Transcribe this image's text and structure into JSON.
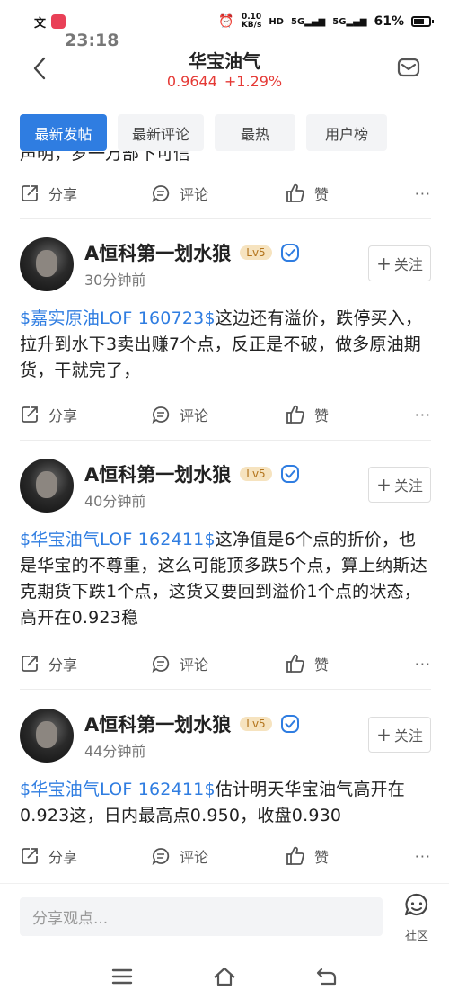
{
  "status": {
    "time": "23:18",
    "speed_value": "0.10",
    "speed_unit": "KB/s",
    "hd": "HD",
    "sig1": "5G",
    "sig2": "5G",
    "battery": "61%"
  },
  "header": {
    "title": "华宝油气",
    "price": "0.9644",
    "change": "+1.29%"
  },
  "tabs": [
    {
      "label": "最新发帖",
      "active": true
    },
    {
      "label": "最新评论",
      "active": false
    },
    {
      "label": "最热",
      "active": false
    },
    {
      "label": "用户榜",
      "active": false
    }
  ],
  "clipped_text": "声明，罗一万部下可信",
  "actions": {
    "share": "分享",
    "comment": "评论",
    "like": "赞",
    "more": "···"
  },
  "posts": [
    {
      "username": "A恒科第一划水狼",
      "level": "Lv5",
      "time": "30分钟前",
      "follow": "关注",
      "tag": "$嘉实原油LOF 160723$",
      "text": "这边还有溢价，跌停买入，拉升到水下3卖出赚7个点，反正是不破，做多原油期货，干就完了，"
    },
    {
      "username": "A恒科第一划水狼",
      "level": "Lv5",
      "time": "40分钟前",
      "follow": "关注",
      "tag": "$华宝油气LOF 162411$",
      "text": "这净值是6个点的折价，也是华宝的不尊重，这么可能顶多跌5个点，算上纳斯达克期货下跌1个点，这货又要回到溢价1个点的状态，高开在0.923稳"
    },
    {
      "username": "A恒科第一划水狼",
      "level": "Lv5",
      "time": "44分钟前",
      "follow": "关注",
      "tag": "$华宝油气LOF 162411$",
      "text": "估计明天华宝油气高开在0.923这，日内最高点0.950，收盘0.930"
    }
  ],
  "composer": {
    "placeholder": "分享观点..."
  },
  "community_label": "社区",
  "colors": {
    "accent": "#2f7de1",
    "up_red": "#e53935",
    "level_bg": "#f6e3bf"
  }
}
